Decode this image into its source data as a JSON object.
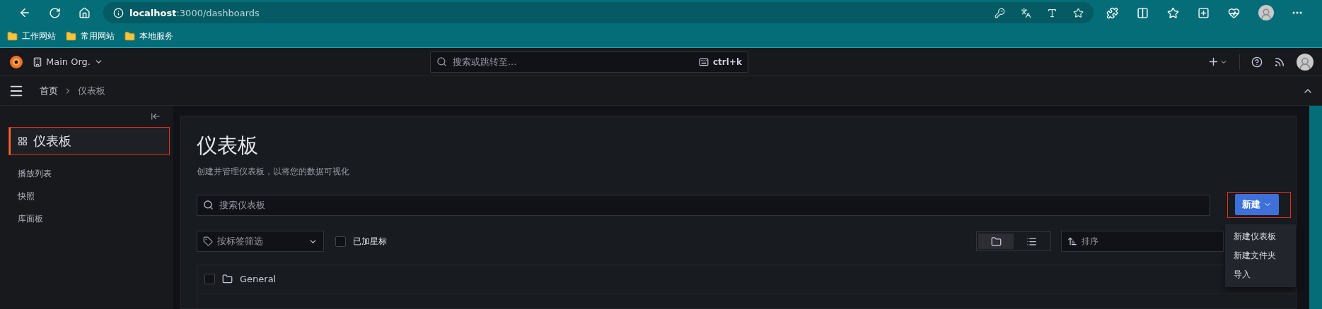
{
  "browser": {
    "url_host": "localhost",
    "url_path": ":3000/dashboards",
    "bookmarks": [
      {
        "label": "工作网站"
      },
      {
        "label": "常用网站"
      },
      {
        "label": "本地服务"
      }
    ]
  },
  "topbar": {
    "org": "Main Org.",
    "search": {
      "placeholder": "搜索或跳转至...",
      "shortcut": "ctrl+k"
    }
  },
  "breadcrumbs": [
    {
      "label": "首页",
      "selected": false
    },
    {
      "label": "仪表板",
      "selected": true
    }
  ],
  "sidebar": {
    "items": [
      {
        "label": "仪表板",
        "selected": true,
        "highlighted": true
      },
      {
        "label": "播放列表",
        "selected": false,
        "highlighted": false
      },
      {
        "label": "快照",
        "selected": false,
        "highlighted": false
      },
      {
        "label": "库面板",
        "selected": false,
        "highlighted": false
      }
    ]
  },
  "page": {
    "title": "仪表板",
    "subtitle": "创建并管理仪表板，以将您的数据可视化",
    "search": {
      "placeholder": "搜索仪表板"
    },
    "new_button": {
      "label": "新建",
      "highlighted": true,
      "expanded": true
    },
    "menu": [
      {
        "label": "新建仪表板"
      },
      {
        "label": "新建文件夹"
      },
      {
        "label": "导入"
      }
    ],
    "tag_filter": {
      "placeholder": "按标签筛选"
    },
    "starred": {
      "label": "已加星标",
      "checked": false
    },
    "views": [
      {
        "kind": "folder",
        "selected": true
      },
      {
        "kind": "list",
        "selected": false
      }
    ],
    "sort": {
      "placeholder": "排序"
    },
    "folders": [
      {
        "name": "General",
        "checked": false
      }
    ]
  }
}
